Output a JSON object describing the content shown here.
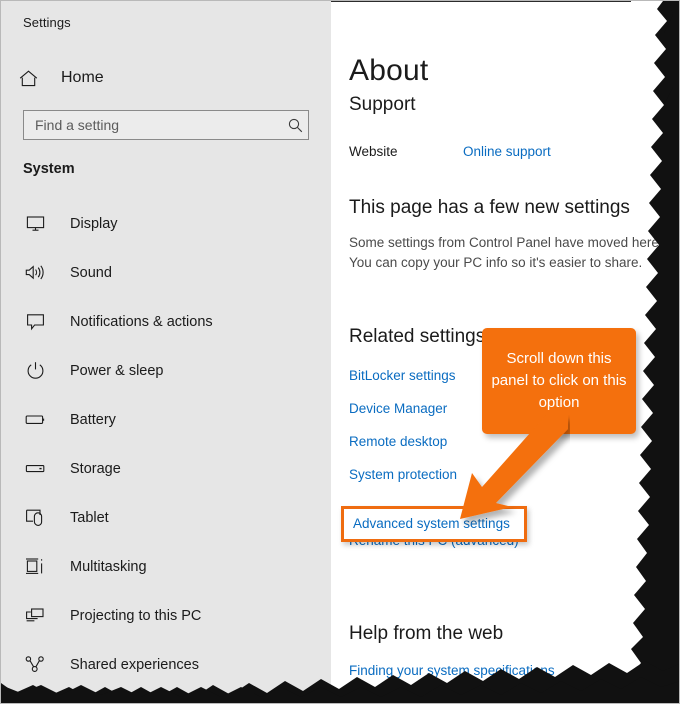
{
  "window": {
    "app_title": "Settings"
  },
  "sidebar": {
    "home": {
      "label": "Home",
      "icon": "home-icon"
    },
    "search": {
      "placeholder": "Find a setting",
      "value": "",
      "icon": "search-icon"
    },
    "section_label": "System",
    "items": [
      {
        "label": "Display",
        "icon": "monitor-icon"
      },
      {
        "label": "Sound",
        "icon": "speaker-icon"
      },
      {
        "label": "Notifications & actions",
        "icon": "notification-bubble-icon"
      },
      {
        "label": "Power & sleep",
        "icon": "power-icon"
      },
      {
        "label": "Battery",
        "icon": "battery-icon"
      },
      {
        "label": "Storage",
        "icon": "storage-drive-icon"
      },
      {
        "label": "Tablet",
        "icon": "tablet-hand-icon"
      },
      {
        "label": "Multitasking",
        "icon": "multitasking-icon"
      },
      {
        "label": "Projecting to this PC",
        "icon": "projecting-screens-icon"
      },
      {
        "label": "Shared experiences",
        "icon": "shared-experiences-icon"
      }
    ]
  },
  "content": {
    "page_title": "About",
    "support": {
      "heading": "Support",
      "website_label": "Website",
      "website_link": "Online support"
    },
    "new_settings": {
      "heading": "This page has a few new settings",
      "body": "Some settings from Control Panel have moved here. You can copy your PC info so it's easier to share."
    },
    "related_settings": {
      "heading": "Related settings",
      "links": [
        "BitLocker settings",
        "Device Manager",
        "Remote desktop",
        "System protection",
        "Rename this PC (advanced)"
      ],
      "highlighted_link": "Advanced system settings"
    },
    "help": {
      "heading": "Help from the web",
      "link": "Finding your system specifications"
    }
  },
  "annotation": {
    "callout_text": "Scroll down this panel to click on this option",
    "accent_color": "#f4700d",
    "highlight_border_color": "#ef6c10",
    "link_color": "#0a6cc1"
  }
}
